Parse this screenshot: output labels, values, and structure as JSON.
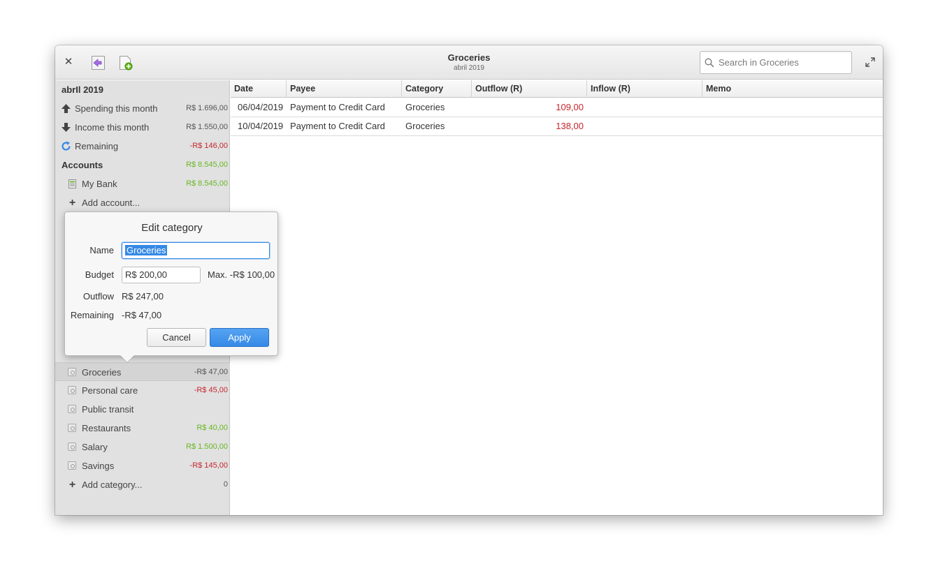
{
  "titlebar": {
    "title": "Groceries",
    "subtitle": "abril 2019",
    "search_placeholder": "Search in Groceries",
    "icons": {
      "close": "close-icon",
      "back": "go-back-icon",
      "new": "new-document-icon",
      "search": "search-icon",
      "maximize": "maximize-icon"
    }
  },
  "sidebar": {
    "period_heading": "abrIl 2019",
    "summary": [
      {
        "label": "Spending this month",
        "value": "R$ 1.696,00",
        "icon": "arrow-up-icon",
        "color": "neutral"
      },
      {
        "label": "Income this month",
        "value": "R$ 1.550,00",
        "icon": "arrow-down-icon",
        "color": "neutral"
      },
      {
        "label": "Remaining",
        "value": "-R$ 146,00",
        "icon": "refresh-icon",
        "color": "red"
      }
    ],
    "accounts_heading": {
      "label": "Accounts",
      "value": "R$ 8.545,00"
    },
    "accounts": [
      {
        "label": "My Bank",
        "value": "R$ 8.545,00",
        "icon": "bank-account-icon"
      }
    ],
    "add_account": "Add account...",
    "categories": [
      {
        "label": "Groceries",
        "value": "-R$ 47,00",
        "color": "neutral",
        "selected": true
      },
      {
        "label": "Personal care",
        "value": "-R$ 45,00",
        "color": "red"
      },
      {
        "label": "Public transit",
        "value": "",
        "color": "neutral"
      },
      {
        "label": "Restaurants",
        "value": "R$ 40,00",
        "color": "green"
      },
      {
        "label": "Salary",
        "value": "R$ 1.500,00",
        "color": "green"
      },
      {
        "label": "Savings",
        "value": "-R$ 145,00",
        "color": "red"
      }
    ],
    "add_category": {
      "label": "Add category...",
      "value": "0"
    }
  },
  "table": {
    "columns": [
      "Date",
      "Payee",
      "Category",
      "Outflow (R)",
      "Inflow (R)",
      "Memo"
    ],
    "rows": [
      {
        "date": "06/04/2019",
        "payee": "Payment to Credit Card",
        "category": "Groceries",
        "outflow": "109,00",
        "inflow": "",
        "memo": ""
      },
      {
        "date": "10/04/2019",
        "payee": "Payment to Credit Card",
        "category": "Groceries",
        "outflow": "138,00",
        "inflow": "",
        "memo": ""
      }
    ]
  },
  "edit_category": {
    "title": "Edit category",
    "name_label": "Name",
    "name_value": "Groceries",
    "budget_label": "Budget",
    "budget_value": "R$ 200,00",
    "budget_max": "Max. -R$ 100,00",
    "outflow_label": "Outflow",
    "outflow_value": "R$ 247,00",
    "remaining_label": "Remaining",
    "remaining_value": "-R$ 47,00",
    "cancel_label": "Cancel",
    "apply_label": "Apply"
  },
  "colors": {
    "accent": "#3689e6",
    "negative": "#c6262e",
    "positive": "#68b723"
  }
}
